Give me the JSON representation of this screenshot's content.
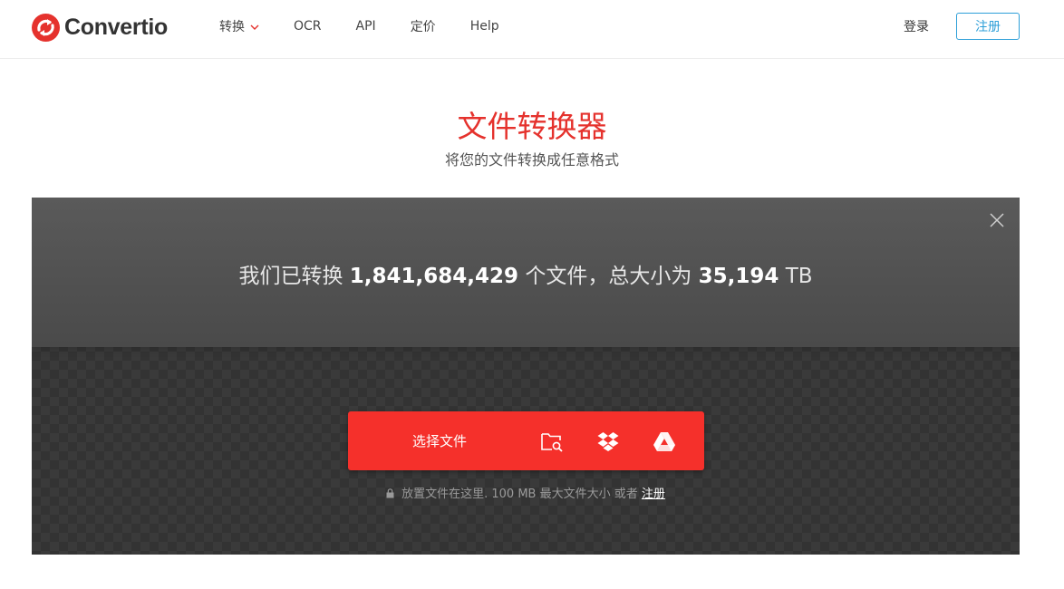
{
  "brand": {
    "name": "Convertio",
    "color": "#e5322d"
  },
  "nav": {
    "items": [
      {
        "label": "转换",
        "dropdown": true
      },
      {
        "label": "OCR"
      },
      {
        "label": "API"
      },
      {
        "label": "定价"
      },
      {
        "label": "Help"
      }
    ],
    "login_label": "登录",
    "signup_label": "注册"
  },
  "hero": {
    "title": "文件转换器",
    "subtitle": "将您的文件转换成任意格式"
  },
  "stats": {
    "prefix": "我们已转换",
    "files_count": "1,841,684,429",
    "middle": "个文件，总大小为",
    "total_size": "35,194",
    "unit": "TB"
  },
  "upload": {
    "button_label": "选择文件",
    "icons": [
      "folder-search-icon",
      "dropbox-icon",
      "google-drive-icon"
    ],
    "hint_text": "放置文件在这里. 100 MB 最大文件大小 或者",
    "hint_link": "注册"
  }
}
